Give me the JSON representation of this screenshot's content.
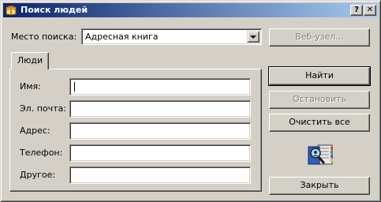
{
  "window": {
    "title": "Поиск людей",
    "help_button": "?",
    "close_button": "✕"
  },
  "search_location": {
    "label": "Место поиска:",
    "selected": "Адресная книга"
  },
  "tabs": [
    {
      "label": "Люди"
    }
  ],
  "fields": [
    {
      "label": "Имя:",
      "value": ""
    },
    {
      "label": "Эл. почта:",
      "value": ""
    },
    {
      "label": "Адрес:",
      "value": ""
    },
    {
      "label": "Телефон:",
      "value": ""
    },
    {
      "label": "Другое:",
      "value": ""
    }
  ],
  "buttons": {
    "website": "Веб-узел...",
    "find": "Найти",
    "stop": "Остановить",
    "clear_all": "Очистить все",
    "close": "Закрыть"
  },
  "icons": {
    "title": "address-book-icon",
    "illustration": "people-search-book-icon"
  }
}
